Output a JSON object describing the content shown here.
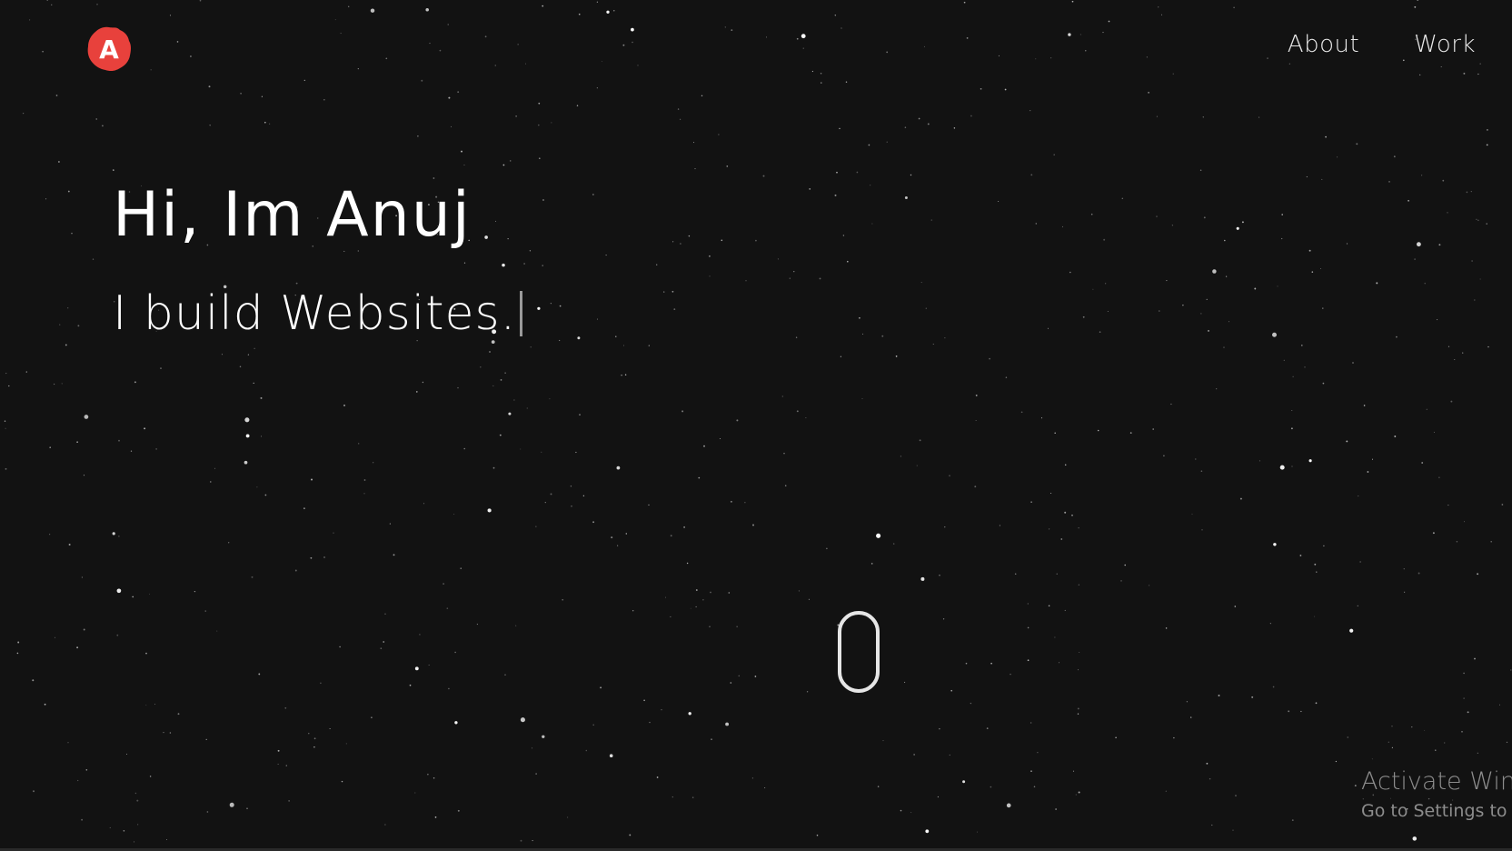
{
  "nav": {
    "logo_letter": "A",
    "links": [
      {
        "label": "About"
      },
      {
        "label": "Work"
      }
    ]
  },
  "hero": {
    "title": "Hi, Im Anuj",
    "subtitle": "I build Websites."
  },
  "watermark": {
    "title": "Activate Win",
    "subtitle": "Go to Settings to"
  },
  "colors": {
    "background": "#121212",
    "logo_red": "#e8413c",
    "text": "#ffffff",
    "nav_text": "#e8e8e8",
    "watermark": "#8c8c8c"
  },
  "icons": {
    "logo": "brand-logo-icon",
    "scroll": "mouse-scroll-icon"
  }
}
